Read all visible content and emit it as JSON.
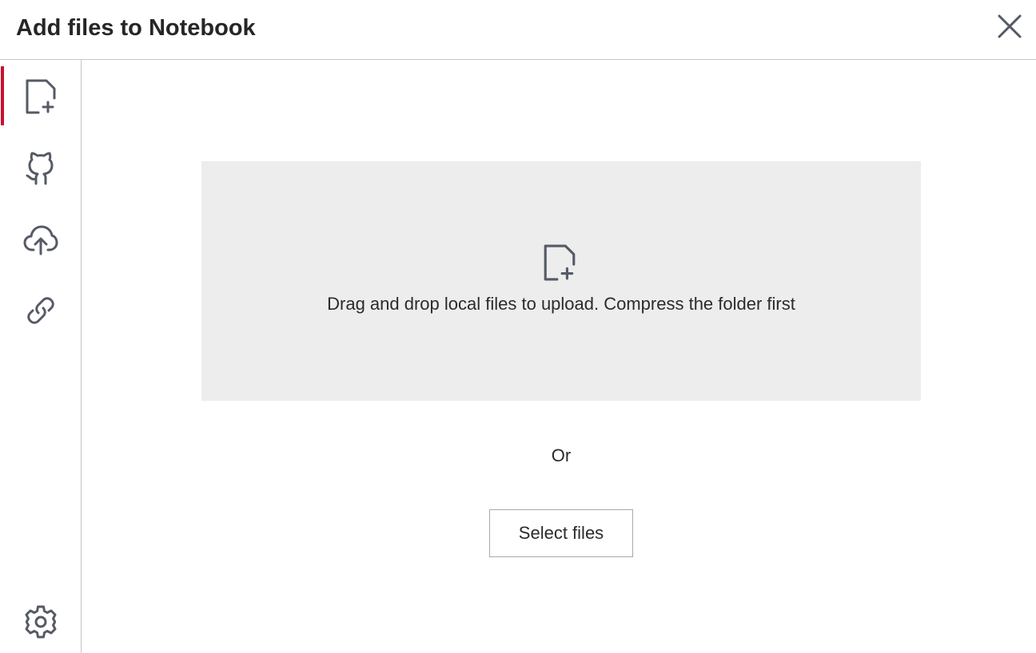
{
  "dialog": {
    "title": "Add files to Notebook",
    "close_icon": "close-icon"
  },
  "sidebar": {
    "items": [
      {
        "name": "upload-file",
        "icon": "file-add-icon",
        "active": true
      },
      {
        "name": "github",
        "icon": "github-icon",
        "active": false
      },
      {
        "name": "cloud-upload",
        "icon": "cloud-upload-icon",
        "active": false
      },
      {
        "name": "link",
        "icon": "link-icon",
        "active": false
      }
    ],
    "settings_icon": "gear-icon",
    "active_indicator_color": "#c8102e"
  },
  "main": {
    "dropzone": {
      "icon": "file-add-icon",
      "text": "Drag and drop local files to upload. Compress the folder first"
    },
    "or_text": "Or",
    "select_button_label": "Select files"
  },
  "colors": {
    "dropzone_bg": "#ededed",
    "icon": "#555a66",
    "accent": "#c8102e"
  }
}
